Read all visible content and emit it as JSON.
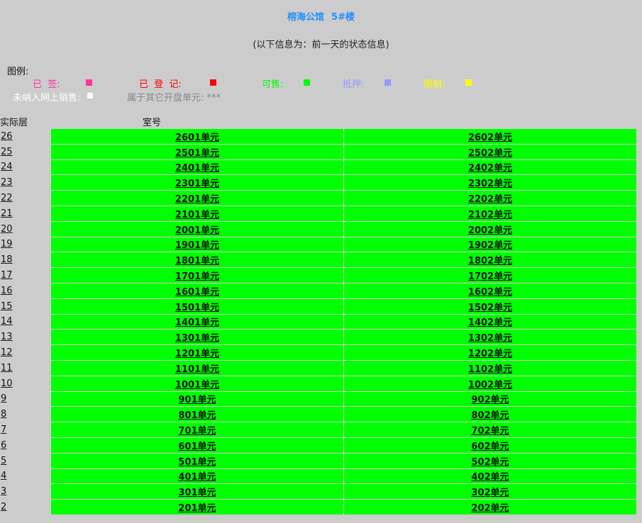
{
  "header": {
    "building": "榕海公馆",
    "block": "5#楼",
    "note": "(以下信息为：前一天的状态信息)"
  },
  "legend": {
    "title": "图例:",
    "items": [
      {
        "label": "已  签:",
        "color": "#ff3399"
      },
      {
        "label": "已  登  记:",
        "color": "#ff0000"
      },
      {
        "label": "可售:",
        "color": "#00ff00"
      },
      {
        "label": "抵押:",
        "color": "#9999ff"
      },
      {
        "label": "限制:",
        "color": "#ffff00"
      }
    ],
    "unlisted_label": "未纳入网上销售:",
    "unlisted_color": "#ffffff",
    "other_label": "属于其它开盘单元: ***"
  },
  "columns": {
    "floor": "实际层",
    "room": "室号"
  },
  "rows": [
    {
      "floor": "26",
      "units": [
        "2601单元",
        "2602单元"
      ]
    },
    {
      "floor": "25",
      "units": [
        "2501单元",
        "2502单元"
      ]
    },
    {
      "floor": "24",
      "units": [
        "2401单元",
        "2402单元"
      ]
    },
    {
      "floor": "23",
      "units": [
        "2301单元",
        "2302单元"
      ]
    },
    {
      "floor": "22",
      "units": [
        "2201单元",
        "2202单元"
      ]
    },
    {
      "floor": "21",
      "units": [
        "2101单元",
        "2102单元"
      ]
    },
    {
      "floor": "20",
      "units": [
        "2001单元",
        "2002单元"
      ]
    },
    {
      "floor": "19",
      "units": [
        "1901单元",
        "1902单元"
      ]
    },
    {
      "floor": "18",
      "units": [
        "1801单元",
        "1802单元"
      ]
    },
    {
      "floor": "17",
      "units": [
        "1701单元",
        "1702单元"
      ]
    },
    {
      "floor": "16",
      "units": [
        "1601单元",
        "1602单元"
      ]
    },
    {
      "floor": "15",
      "units": [
        "1501单元",
        "1502单元"
      ]
    },
    {
      "floor": "14",
      "units": [
        "1401单元",
        "1402单元"
      ]
    },
    {
      "floor": "13",
      "units": [
        "1301单元",
        "1302单元"
      ]
    },
    {
      "floor": "12",
      "units": [
        "1201单元",
        "1202单元"
      ]
    },
    {
      "floor": "11",
      "units": [
        "1101单元",
        "1102单元"
      ]
    },
    {
      "floor": "10",
      "units": [
        "1001单元",
        "1002单元"
      ]
    },
    {
      "floor": "9",
      "units": [
        "901单元",
        "902单元"
      ]
    },
    {
      "floor": "8",
      "units": [
        "801单元",
        "802单元"
      ]
    },
    {
      "floor": "7",
      "units": [
        "701单元",
        "702单元"
      ]
    },
    {
      "floor": "6",
      "units": [
        "601单元",
        "602单元"
      ]
    },
    {
      "floor": "5",
      "units": [
        "501单元",
        "502单元"
      ]
    },
    {
      "floor": "4",
      "units": [
        "401单元",
        "402单元"
      ]
    },
    {
      "floor": "3",
      "units": [
        "301单元",
        "302单元"
      ]
    },
    {
      "floor": "2",
      "units": [
        "201单元",
        "202单元"
      ]
    }
  ]
}
